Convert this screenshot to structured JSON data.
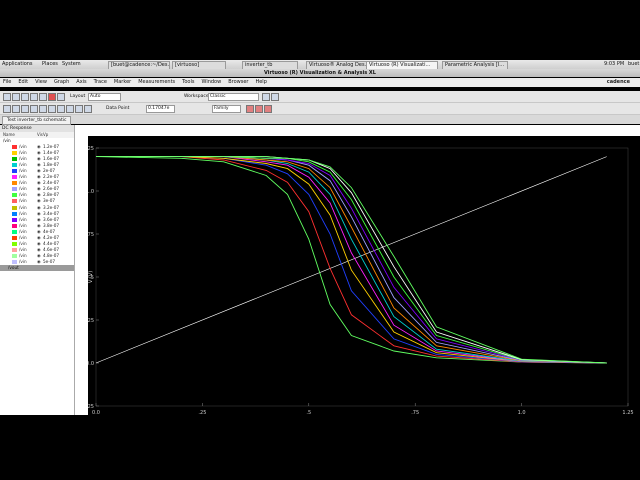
{
  "panel": {
    "menu": [
      "Applications",
      "Places",
      "System"
    ],
    "tasks": [
      "[buet@cadence:~/Des...",
      "[virtuoso]",
      "inverter_tb",
      "Virtuoso® Analog Des...",
      "Virtuoso (R) Visualizati...",
      "Parametric Analysis [I..."
    ],
    "clock": "9:03 PM",
    "user": "buet"
  },
  "window": {
    "title": "Virtuoso (R) Visualization & Analysis XL",
    "brand": "cadence"
  },
  "menubar": [
    "File",
    "Edit",
    "View",
    "Graph",
    "Axis",
    "Trace",
    "Marker",
    "Measurements",
    "Tools",
    "Window",
    "Browser",
    "Help"
  ],
  "toolbar": {
    "layout_label": "Layout",
    "layout_value": "Auto",
    "workspace_label": "Workspace:",
    "workspace_value": "Classic",
    "datapoint_label": "Data Point",
    "datapoint_value": "0.17047e",
    "style_value": "Family"
  },
  "tab": {
    "label": "Test inverter_tb schematic"
  },
  "sidebar": {
    "title": "DC Response",
    "col_name": "Name",
    "col_vis": "Vis",
    "col_vp": "Vp",
    "group": "/vin",
    "traces": [
      {
        "name": "/vin",
        "val": "1.2e-07",
        "color": "#ff3030"
      },
      {
        "name": "/vin",
        "val": "1.4e-07",
        "color": "#ffd000"
      },
      {
        "name": "/vin",
        "val": "1.6e-07",
        "color": "#00c000"
      },
      {
        "name": "/vin",
        "val": "1.8e-07",
        "color": "#00d0d0"
      },
      {
        "name": "/vin",
        "val": "2e-07",
        "color": "#2040ff"
      },
      {
        "name": "/vin",
        "val": "2.2e-07",
        "color": "#ff20ff"
      },
      {
        "name": "/vin",
        "val": "2.4e-07",
        "color": "#ff8800"
      },
      {
        "name": "/vin",
        "val": "2.6e-07",
        "color": "#a0a0ff"
      },
      {
        "name": "/vin",
        "val": "2.8e-07",
        "color": "#40ff40"
      },
      {
        "name": "/vin",
        "val": "3e-07",
        "color": "#ff6060"
      },
      {
        "name": "/vin",
        "val": "3.2e-07",
        "color": "#c0c000"
      },
      {
        "name": "/vin",
        "val": "3.4e-07",
        "color": "#0080ff"
      },
      {
        "name": "/vin",
        "val": "3.6e-07",
        "color": "#8000ff"
      },
      {
        "name": "/vin",
        "val": "3.8e-07",
        "color": "#ff0080"
      },
      {
        "name": "/vin",
        "val": "4e-07",
        "color": "#00ff80"
      },
      {
        "name": "/vin",
        "val": "4.2e-07",
        "color": "#ff4000"
      },
      {
        "name": "/vin",
        "val": "4.4e-07",
        "color": "#80ff00"
      },
      {
        "name": "/vin",
        "val": "4.6e-07",
        "color": "#ffa0a0"
      },
      {
        "name": "/vin",
        "val": "4.8e-07",
        "color": "#a0ffa0"
      },
      {
        "name": "/vin",
        "val": "5e-07",
        "color": "#c0c0ff"
      }
    ],
    "selected": "/vout"
  },
  "chart_data": {
    "type": "line",
    "ylabel": "V (V)",
    "xlim": [
      0.0,
      1.25
    ],
    "ylim": [
      -0.25,
      1.25
    ],
    "xticks": [
      "0.0",
      ".25",
      ".5",
      ".75",
      "1.0",
      "1.25"
    ],
    "yticks": [
      "1.25",
      "1.0",
      ".75",
      ".5",
      ".25",
      "0.0",
      "-.25"
    ],
    "series": [
      {
        "color": "#ffffff",
        "x": [
          0.0,
          1.2
        ],
        "y": [
          0.0,
          1.2
        ]
      },
      {
        "color": "#60ff60",
        "x": [
          0.0,
          0.2,
          0.3,
          0.4,
          0.45,
          0.5,
          0.55,
          0.6,
          0.7,
          0.8,
          1.0,
          1.2
        ],
        "y": [
          1.2,
          1.19,
          1.17,
          1.09,
          0.98,
          0.72,
          0.34,
          0.16,
          0.07,
          0.03,
          0.005,
          0.0
        ]
      },
      {
        "color": "#ff3030",
        "x": [
          0.0,
          0.2,
          0.3,
          0.4,
          0.45,
          0.5,
          0.55,
          0.6,
          0.7,
          0.8,
          1.0,
          1.2
        ],
        "y": [
          1.2,
          1.2,
          1.18,
          1.12,
          1.05,
          0.88,
          0.55,
          0.28,
          0.1,
          0.04,
          0.006,
          0.0
        ]
      },
      {
        "color": "#2040ff",
        "x": [
          0.0,
          0.2,
          0.3,
          0.4,
          0.45,
          0.5,
          0.55,
          0.6,
          0.7,
          0.8,
          1.0,
          1.2
        ],
        "y": [
          1.2,
          1.2,
          1.19,
          1.15,
          1.1,
          0.98,
          0.75,
          0.42,
          0.14,
          0.05,
          0.007,
          0.0
        ]
      },
      {
        "color": "#ffd000",
        "x": [
          0.0,
          0.2,
          0.3,
          0.4,
          0.45,
          0.5,
          0.55,
          0.6,
          0.7,
          0.8,
          1.0,
          1.2
        ],
        "y": [
          1.2,
          1.2,
          1.19,
          1.16,
          1.13,
          1.04,
          0.86,
          0.54,
          0.18,
          0.06,
          0.008,
          0.0
        ]
      },
      {
        "color": "#ff20ff",
        "x": [
          0.0,
          0.2,
          0.3,
          0.4,
          0.45,
          0.5,
          0.55,
          0.6,
          0.7,
          0.8,
          1.0,
          1.2
        ],
        "y": [
          1.2,
          1.2,
          1.2,
          1.17,
          1.15,
          1.08,
          0.93,
          0.64,
          0.22,
          0.07,
          0.009,
          0.0
        ]
      },
      {
        "color": "#00d0d0",
        "x": [
          0.0,
          0.2,
          0.3,
          0.4,
          0.45,
          0.5,
          0.55,
          0.6,
          0.7,
          0.8,
          1.0,
          1.2
        ],
        "y": [
          1.2,
          1.2,
          1.2,
          1.18,
          1.16,
          1.11,
          0.98,
          0.72,
          0.27,
          0.08,
          0.01,
          0.0
        ]
      },
      {
        "color": "#ff8800",
        "x": [
          0.0,
          0.2,
          0.3,
          0.4,
          0.45,
          0.5,
          0.55,
          0.6,
          0.7,
          0.8,
          1.0,
          1.2
        ],
        "y": [
          1.2,
          1.2,
          1.2,
          1.18,
          1.17,
          1.13,
          1.02,
          0.79,
          0.32,
          0.1,
          0.012,
          0.0
        ]
      },
      {
        "color": "#a0a0ff",
        "x": [
          0.0,
          0.2,
          0.3,
          0.4,
          0.45,
          0.5,
          0.55,
          0.6,
          0.7,
          0.8,
          1.0,
          1.2
        ],
        "y": [
          1.2,
          1.2,
          1.2,
          1.19,
          1.18,
          1.15,
          1.06,
          0.85,
          0.38,
          0.12,
          0.014,
          0.0
        ]
      },
      {
        "color": "#8000ff",
        "x": [
          0.0,
          0.2,
          0.3,
          0.4,
          0.45,
          0.5,
          0.55,
          0.6,
          0.7,
          0.8,
          1.0,
          1.2
        ],
        "y": [
          1.2,
          1.2,
          1.2,
          1.19,
          1.18,
          1.16,
          1.09,
          0.9,
          0.44,
          0.14,
          0.016,
          0.0
        ]
      },
      {
        "color": "#40ff40",
        "x": [
          0.0,
          0.2,
          0.3,
          0.4,
          0.45,
          0.5,
          0.55,
          0.6,
          0.7,
          0.8,
          1.0,
          1.2
        ],
        "y": [
          1.2,
          1.2,
          1.2,
          1.19,
          1.19,
          1.17,
          1.11,
          0.95,
          0.5,
          0.16,
          0.018,
          0.0
        ]
      },
      {
        "color": "#ffffff",
        "x": [
          0.0,
          0.2,
          0.3,
          0.4,
          0.45,
          0.5,
          0.55,
          0.6,
          0.7,
          0.8,
          1.0,
          1.2
        ],
        "y": [
          1.2,
          1.2,
          1.2,
          1.2,
          1.19,
          1.18,
          1.13,
          0.99,
          0.56,
          0.18,
          0.02,
          0.0
        ]
      },
      {
        "color": "#60ff60",
        "x": [
          0.0,
          0.2,
          0.3,
          0.4,
          0.45,
          0.5,
          0.55,
          0.6,
          0.7,
          0.8,
          1.0,
          1.2
        ],
        "y": [
          1.2,
          1.2,
          1.2,
          1.2,
          1.19,
          1.18,
          1.14,
          1.02,
          0.62,
          0.21,
          0.022,
          0.0
        ]
      }
    ]
  }
}
